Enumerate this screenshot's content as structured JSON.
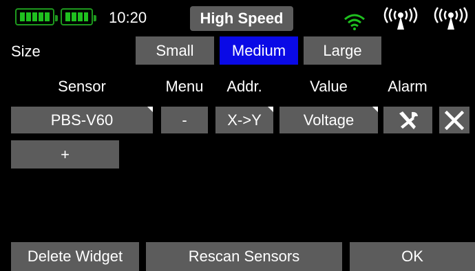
{
  "status_bar": {
    "time": "10:20",
    "mode": "High Speed",
    "icons": [
      "battery-icon",
      "battery-icon",
      "wifi-icon",
      "antenna-signal-icon",
      "antenna-signal-icon"
    ]
  },
  "size_row": {
    "label": "Size",
    "options": [
      "Small",
      "Medium",
      "Large"
    ],
    "selected": "Medium"
  },
  "table": {
    "headers": {
      "sensor": "Sensor",
      "menu": "Menu",
      "addr": "Addr.",
      "value": "Value",
      "alarm": "Alarm"
    },
    "rows": [
      {
        "sensor": "PBS-V60",
        "menu": "-",
        "addr": "X->Y",
        "value": "Voltage",
        "alarm_icon": "tools-icon",
        "delete_icon": "close-icon"
      }
    ],
    "add_label": "+"
  },
  "footer": {
    "delete_widget": "Delete Widget",
    "rescan_sensors": "Rescan Sensors",
    "ok": "OK"
  },
  "colors": {
    "button_bg": "#5c5c5c",
    "selected_bg": "#0a0ae6",
    "battery_green": "#1fc01f",
    "wifi_green": "#1fc01f"
  }
}
